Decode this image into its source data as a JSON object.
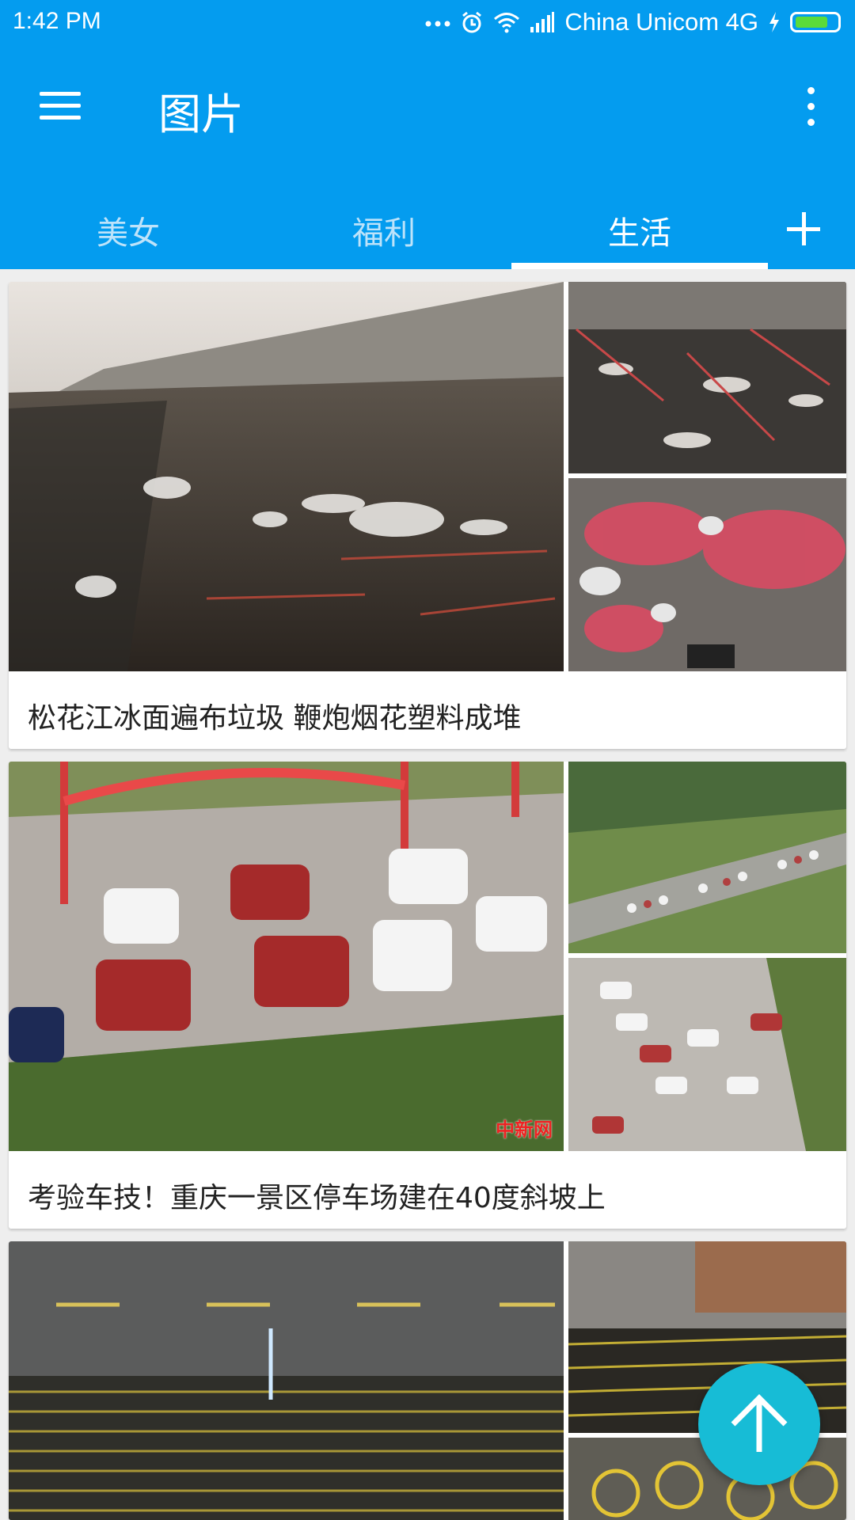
{
  "status_bar": {
    "time": "1:42 PM",
    "carrier": "China Unicom 4G"
  },
  "app_bar": {
    "title": "图片"
  },
  "tabs": [
    {
      "label": "美女",
      "active": false
    },
    {
      "label": "福利",
      "active": false
    },
    {
      "label": "生活",
      "active": true
    }
  ],
  "cards": [
    {
      "caption": "松花江冰面遍布垃圾 鞭炮烟花塑料成堆"
    },
    {
      "caption": "考验车技！重庆一景区停车场建在40度斜坡上",
      "watermark": "中新网"
    },
    {
      "caption": ""
    }
  ],
  "colors": {
    "primary": "#049cef",
    "fab": "#17bcd6",
    "tab_active": "#ffffff",
    "tab_inactive": "#bde3fa"
  }
}
